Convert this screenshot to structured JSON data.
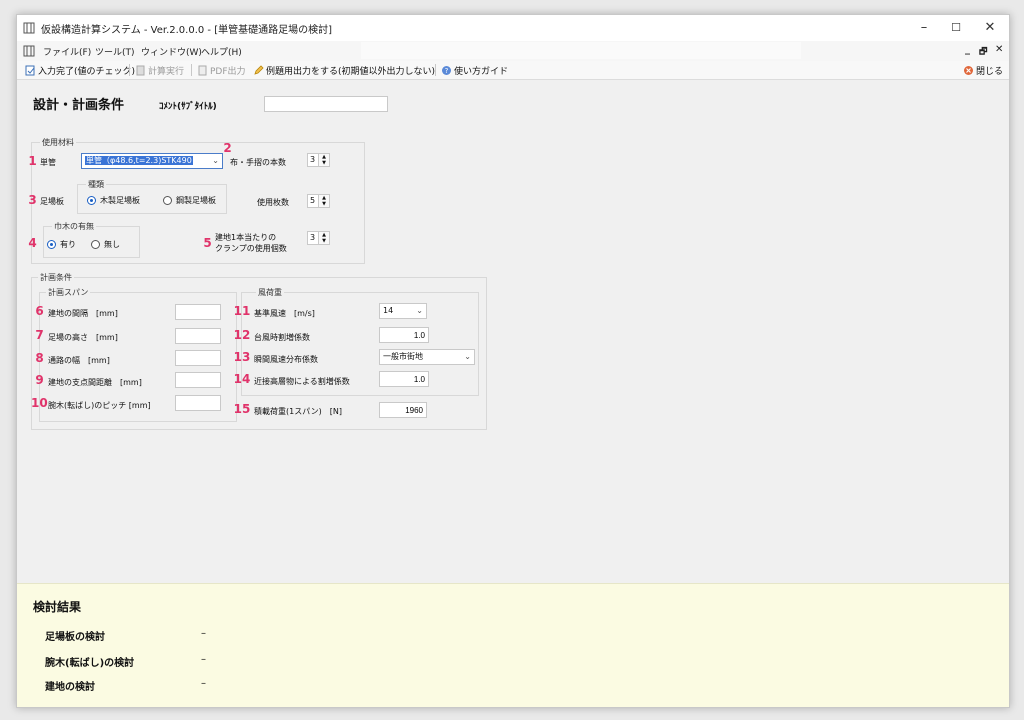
{
  "window": {
    "title": "仮設構造計算システム - Ver.2.0.0.0 - [単管基礎通路足場の検討]",
    "controls": {
      "minimize": "–",
      "maximize": "☐",
      "close": "✕"
    }
  },
  "menu": {
    "items": [
      "ファイル(F)",
      "ツール(T)",
      "ウィンドウ(W)",
      "ヘルプ(H)"
    ],
    "mdi_controls": {
      "minimize": "_",
      "restore": "🗗",
      "close": "✕"
    }
  },
  "toolbar": {
    "input_done": "入力完了(値のチェック)",
    "calc": "計算実行",
    "pdf": "PDF出力",
    "example_output": "例題用出力をする(初期値以外出力しない)",
    "guide": "使い方ガイド",
    "close": "閉じる"
  },
  "design": {
    "title": "設計・計画条件",
    "comment_label": "ｺﾒﾝﾄ(ｻﾌﾞﾀｲﾄﾙ)",
    "comment_value": ""
  },
  "materials": {
    "group_title": "使用材料",
    "pipe": {
      "number": "1",
      "label": "単管",
      "value": "単管（φ48.6,t=2.3)STK490"
    },
    "handrail": {
      "number": "2",
      "label": "布・手摺の本数",
      "value": "3"
    },
    "board": {
      "number": "3",
      "label": "足場板",
      "type_title": "種類",
      "options": [
        "木製足場板",
        "鋼製足場板"
      ],
      "usage_label": "使用枚数",
      "usage_value": "5"
    },
    "toeboard": {
      "number": "4",
      "title": "巾木の有無",
      "options": [
        "有り",
        "無し"
      ]
    },
    "clamp": {
      "number": "5",
      "label_line1": "建地1本当たりの",
      "label_line2": "クランプの使用個数",
      "value": "3"
    }
  },
  "plan": {
    "group_title": "計画条件",
    "span_title": "計画スパン",
    "items": [
      {
        "number": "6",
        "label": "建地の間隔　[mm]",
        "value": ""
      },
      {
        "number": "7",
        "label": "足場の高さ　[mm]",
        "value": ""
      },
      {
        "number": "8",
        "label": "通路の幅　[mm]",
        "value": ""
      },
      {
        "number": "9",
        "label": "建地の支点間距離　[mm]",
        "value": ""
      },
      {
        "number": "10",
        "label": "腕木(転ばし)のピッチ [mm]",
        "value": ""
      }
    ],
    "wind_title": "風荷重",
    "wind": [
      {
        "number": "11",
        "label": "基準風速　[m/s]",
        "value": "14"
      },
      {
        "number": "12",
        "label": "台風時割増係数",
        "value": "1.0"
      },
      {
        "number": "13",
        "label": "瞬間風速分布係数",
        "value": "一般市街地"
      },
      {
        "number": "14",
        "label": "近接高層物による割増係数",
        "value": "1.0"
      }
    ],
    "load": {
      "number": "15",
      "label": "積載荷重(1スパン)　[N]",
      "value": "1960"
    }
  },
  "results": {
    "title": "検討結果",
    "items": [
      {
        "label": "足場板の検討",
        "value": "–"
      },
      {
        "label": "腕木(転ばし)の検討",
        "value": "–"
      },
      {
        "label": "建地の検討",
        "value": "–"
      }
    ]
  },
  "colors": {
    "accent": "#e0336a",
    "radio": "#1a5fc4",
    "results_bg": "#fbfbe2"
  }
}
